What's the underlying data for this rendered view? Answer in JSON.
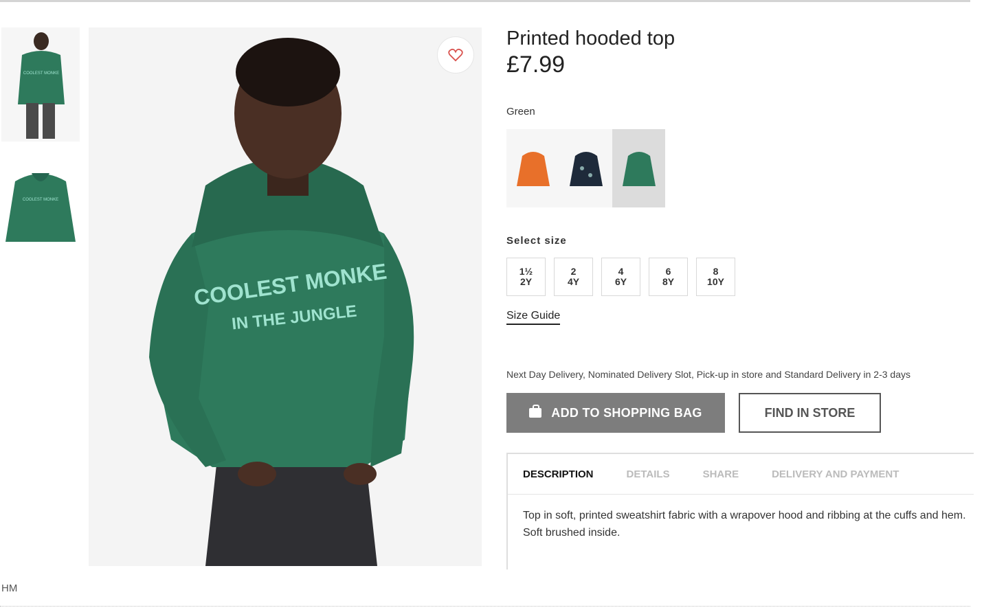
{
  "product": {
    "title": "Printed hooded top",
    "price": "£7.99",
    "color_label": "Green",
    "hoodie_print_line1": "COOLEST MONKE",
    "hoodie_print_line2": "IN THE JUNGLE",
    "swatches": [
      {
        "name": "orange",
        "color": "#e8702a"
      },
      {
        "name": "navy-print",
        "color": "#1e2a3a"
      },
      {
        "name": "green",
        "color": "#2e7a5c",
        "selected": true
      }
    ]
  },
  "size": {
    "label": "Select size",
    "options": [
      {
        "top": "1½",
        "bottom": "2Y"
      },
      {
        "top": "2",
        "bottom": "4Y"
      },
      {
        "top": "4",
        "bottom": "6Y"
      },
      {
        "top": "6",
        "bottom": "8Y"
      },
      {
        "top": "8",
        "bottom": "10Y"
      }
    ],
    "guide_label": "Size Guide"
  },
  "delivery_text": "Next Day Delivery, Nominated Delivery Slot, Pick-up in store and Standard Delivery in 2-3 days",
  "buttons": {
    "add_to_bag": "ADD TO SHOPPING BAG",
    "find_in_store": "FIND IN STORE"
  },
  "tabs": [
    {
      "label": "DESCRIPTION",
      "active": true
    },
    {
      "label": "DETAILS"
    },
    {
      "label": "SHARE"
    },
    {
      "label": "DELIVERY AND PAYMENT"
    }
  ],
  "description": "Top in soft, printed sweatshirt fabric with a wrapover hood and ribbing at the cuffs and hem. Soft brushed inside.",
  "credit": "HM",
  "colors": {
    "hoodie_green": "#2e7a5c",
    "print_mint": "#9fe3cf",
    "button_grey": "#7d7d7d"
  }
}
